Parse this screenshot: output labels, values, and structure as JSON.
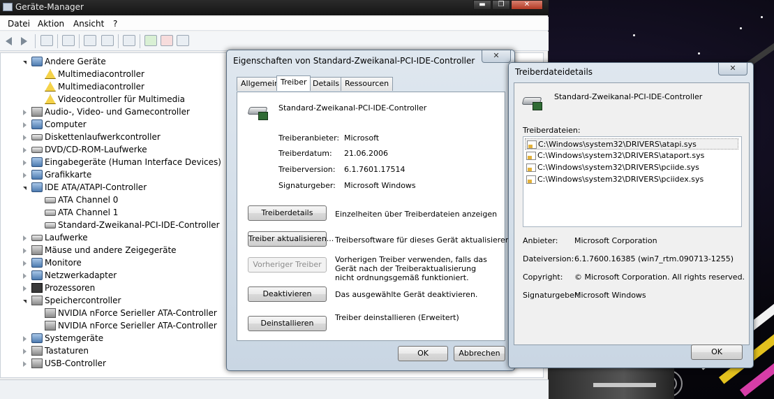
{
  "device_manager": {
    "title": "Geräte-Manager",
    "window_buttons": {
      "minimize": "▬",
      "maximize": "❐",
      "close": "✕"
    },
    "menu": [
      "Datei",
      "Aktion",
      "Ansicht",
      "?"
    ],
    "tree": [
      {
        "label": "Andere Geräte",
        "level": 0,
        "expanded": true,
        "icon": "device-category-icon"
      },
      {
        "label": "Multimediacontroller",
        "level": 1,
        "icon": "warning-device-icon"
      },
      {
        "label": "Multimediacontroller",
        "level": 1,
        "icon": "warning-device-icon"
      },
      {
        "label": "Videocontroller für Multimedia",
        "level": 1,
        "icon": "warning-device-icon"
      },
      {
        "label": "Audio-, Video- und Gamecontroller",
        "level": 0,
        "expanded": false,
        "icon": "speaker-icon"
      },
      {
        "label": "Computer",
        "level": 0,
        "expanded": false,
        "icon": "computer-icon"
      },
      {
        "label": "Diskettenlaufwerkcontroller",
        "level": 0,
        "expanded": false,
        "icon": "floppy-controller-icon"
      },
      {
        "label": "DVD/CD-ROM-Laufwerke",
        "level": 0,
        "expanded": false,
        "icon": "disc-drive-icon"
      },
      {
        "label": "Eingabegeräte (Human Interface Devices)",
        "level": 0,
        "expanded": false,
        "icon": "hid-icon"
      },
      {
        "label": "Grafikkarte",
        "level": 0,
        "expanded": false,
        "icon": "display-adapter-icon"
      },
      {
        "label": "IDE ATA/ATAPI-Controller",
        "level": 0,
        "expanded": true,
        "icon": "ide-controller-icon"
      },
      {
        "label": "ATA Channel 0",
        "level": 1,
        "icon": "ide-channel-icon"
      },
      {
        "label": "ATA Channel 1",
        "level": 1,
        "icon": "ide-channel-icon"
      },
      {
        "label": "Standard-Zweikanal-PCI-IDE-Controller",
        "level": 1,
        "icon": "ide-channel-icon"
      },
      {
        "label": "Laufwerke",
        "level": 0,
        "expanded": false,
        "icon": "disk-drive-icon"
      },
      {
        "label": "Mäuse und andere Zeigegeräte",
        "level": 0,
        "expanded": false,
        "icon": "mouse-icon"
      },
      {
        "label": "Monitore",
        "level": 0,
        "expanded": false,
        "icon": "monitor-icon"
      },
      {
        "label": "Netzwerkadapter",
        "level": 0,
        "expanded": false,
        "icon": "network-adapter-icon"
      },
      {
        "label": "Prozessoren",
        "level": 0,
        "expanded": false,
        "icon": "processor-icon"
      },
      {
        "label": "Speichercontroller",
        "level": 0,
        "expanded": true,
        "icon": "storage-controller-icon"
      },
      {
        "label": "NVIDIA nForce Serieller ATA-Controller",
        "level": 1,
        "icon": "storage-controller-icon"
      },
      {
        "label": "NVIDIA nForce Serieller ATA-Controller",
        "level": 1,
        "icon": "storage-controller-icon"
      },
      {
        "label": "Systemgeräte",
        "level": 0,
        "expanded": false,
        "icon": "system-device-icon"
      },
      {
        "label": "Tastaturen",
        "level": 0,
        "expanded": false,
        "icon": "keyboard-icon"
      },
      {
        "label": "USB-Controller",
        "level": 0,
        "expanded": false,
        "icon": "usb-icon"
      }
    ]
  },
  "properties_dialog": {
    "title": "Eigenschaften von Standard-Zweikanal-PCI-IDE-Controller",
    "close_label": "✕",
    "tabs": [
      {
        "label": "Allgemein",
        "active": false
      },
      {
        "label": "Treiber",
        "active": true
      },
      {
        "label": "Details",
        "active": false
      },
      {
        "label": "Ressourcen",
        "active": false
      }
    ],
    "device_name": "Standard-Zweikanal-PCI-IDE-Controller",
    "fields": [
      {
        "label": "Treiberanbieter:",
        "value": "Microsoft"
      },
      {
        "label": "Treiberdatum:",
        "value": "21.06.2006"
      },
      {
        "label": "Treiberversion:",
        "value": "6.1.7601.17514"
      },
      {
        "label": "Signaturgeber:",
        "value": "Microsoft Windows"
      }
    ],
    "actions": [
      {
        "button": "Treiberdetails",
        "description": "Einzelheiten über Treiberdateien anzeigen",
        "enabled": true
      },
      {
        "button": "Treiber aktualisieren...",
        "description": "Treibersoftware für dieses Gerät aktualisieren",
        "enabled": true
      },
      {
        "button": "Vorheriger Treiber",
        "description": "Vorherigen Treiber verwenden, falls das Gerät nach der Treiberaktualisierung nicht ordnungsgemäß funktioniert.",
        "enabled": false
      },
      {
        "button": "Deaktivieren",
        "description": "Das ausgewählte Gerät deaktivieren.",
        "enabled": true
      },
      {
        "button": "Deinstallieren",
        "description": "Treiber deinstallieren (Erweitert)",
        "enabled": true
      }
    ],
    "ok_label": "OK",
    "cancel_label": "Abbrechen"
  },
  "file_details_dialog": {
    "title": "Treiberdateidetails",
    "close_label": "✕",
    "device_name": "Standard-Zweikanal-PCI-IDE-Controller",
    "files_label": "Treiberdateien:",
    "files": [
      "C:\\Windows\\system32\\DRIVERS\\atapi.sys",
      "C:\\Windows\\system32\\DRIVERS\\ataport.sys",
      "C:\\Windows\\system32\\DRIVERS\\pciide.sys",
      "C:\\Windows\\system32\\DRIVERS\\pciidex.sys"
    ],
    "selected_file_index": 0,
    "fields": [
      {
        "label": "Anbieter:",
        "value": "Microsoft Corporation"
      },
      {
        "label": "Dateiversion:",
        "value": "6.1.7600.16385 (win7_rtm.090713-1255)"
      },
      {
        "label": "Copyright:",
        "value": "© Microsoft Corporation. All rights reserved."
      },
      {
        "label": "Signaturgeber:",
        "value": "Microsoft Windows"
      }
    ],
    "ok_label": "OK"
  }
}
